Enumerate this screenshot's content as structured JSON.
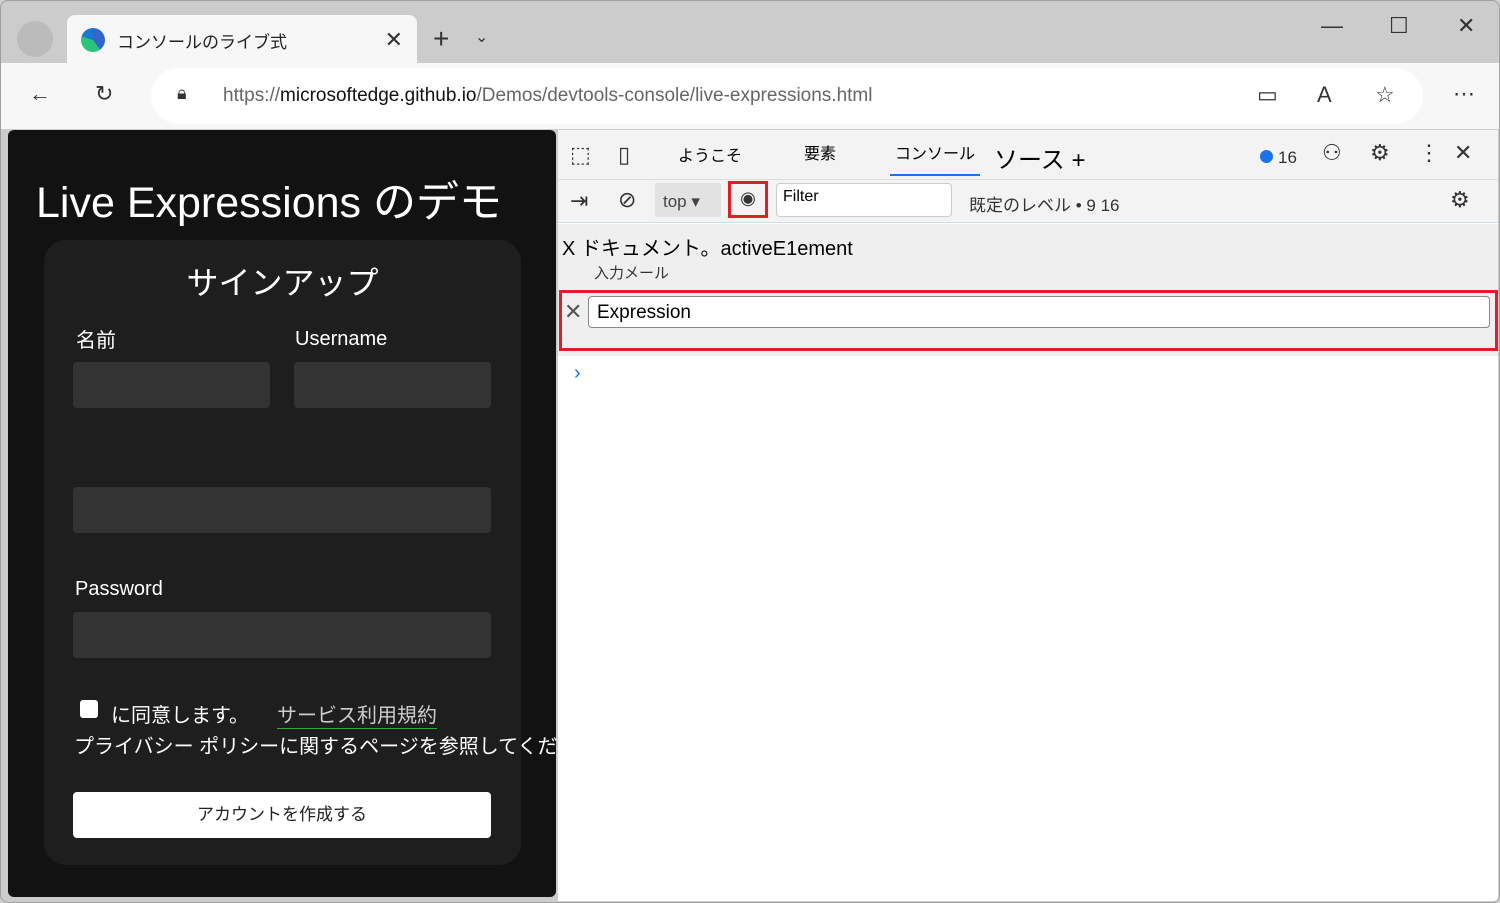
{
  "browser": {
    "tab_title": "コンソールのライブ式",
    "url_prefix": "https://",
    "url_host": "microsoftedge.github.io",
    "url_path": "/Demos/devtools-console/live-expressions.html"
  },
  "page": {
    "heading": "Live Expressions のデモ",
    "card_title": "サインアップ",
    "name_label": "名前",
    "username_label": "Username",
    "password_label": "Password",
    "agree_text": "に同意します。",
    "terms_link": "サービス利用規約",
    "privacy_text": "プライバシー ポリシーに関するページを参照してください",
    "create_button": "アカウントを作成する"
  },
  "devtools": {
    "tabs": [
      "ようこそ",
      "要素",
      "コンソール",
      "ソース +"
    ],
    "issues_count": "16",
    "context": "top",
    "filter_placeholder": "Filter",
    "levels": "既定のレベル • 9 16",
    "expression1": "X ドキュメント。activeE1ement",
    "expression1_value": "入力メール",
    "expression_input": "Expression"
  }
}
